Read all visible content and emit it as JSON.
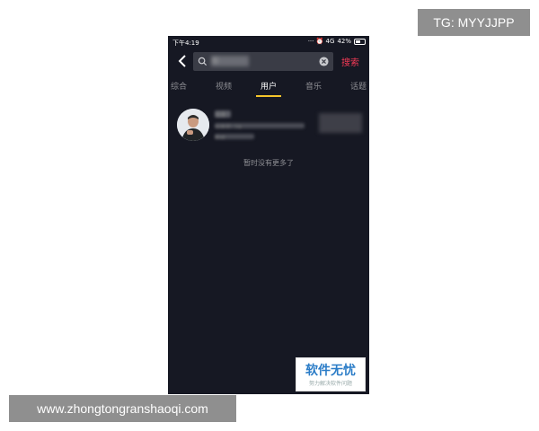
{
  "watermarks": {
    "tg_badge": "TG: MYYJJPP",
    "site_url": "www.zhongtongranshaoqi.com",
    "logo_main": "软件无忧",
    "logo_sub": "努力解决软件问题"
  },
  "status_bar": {
    "time": "下午4:19",
    "indicators": "··· ⏰ 4G",
    "battery": "42%"
  },
  "search": {
    "query_blurred": "加",
    "button_label": "搜索"
  },
  "tabs": [
    {
      "label": "综合",
      "active": false
    },
    {
      "label": "视频",
      "active": false
    },
    {
      "label": "用户",
      "active": true
    },
    {
      "label": "音乐",
      "active": false
    },
    {
      "label": "话题",
      "active": false
    }
  ],
  "results": {
    "user_name_blurred": "加速",
    "user_id_blurred": "抖音号: 2A",
    "fans_blurred": "粉丝",
    "end_message": "暂时没有更多了"
  },
  "colors": {
    "app_bg": "#161823",
    "accent": "#f23a56",
    "tab_indicator": "#f5c52b"
  }
}
